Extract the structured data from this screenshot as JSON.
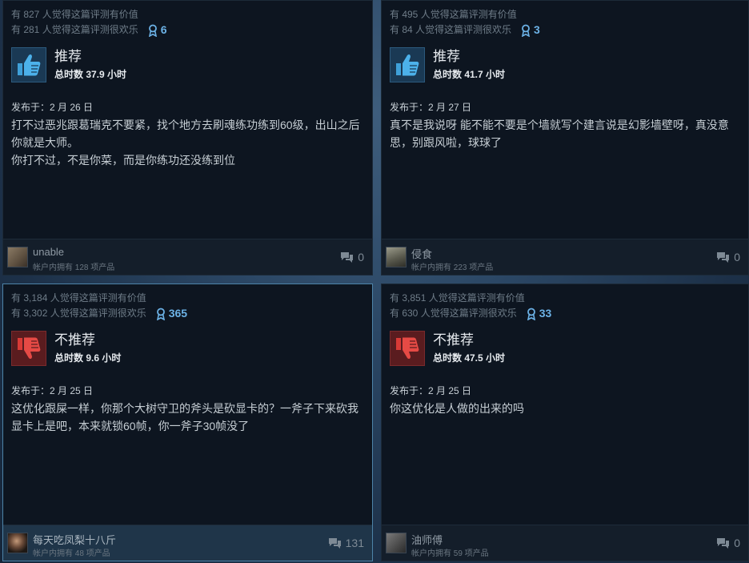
{
  "reviews": [
    {
      "helpful": "有 827 人觉得这篇评测有价值",
      "funny": "有 281 人觉得这篇评测很欢乐",
      "awards": "6",
      "recommendation": "推荐",
      "hours": "总时数 37.9 小时",
      "posted": "发布于：2 月 26 日",
      "text": [
        "打不过恶兆跟葛瑞克不要紧，找个地方去刷魂练功练到60级，出山之后你就是大师。",
        "你打不过，不是你菜，而是你练功还没练到位"
      ],
      "username": "unable",
      "products": "帐户内拥有 128 项产品",
      "comments": "0"
    },
    {
      "helpful": "有 495 人觉得这篇评测有价值",
      "funny": "有 84 人觉得这篇评测很欢乐",
      "awards": "3",
      "recommendation": "推荐",
      "hours": "总时数 41.7 小时",
      "posted": "发布于：2 月 27 日",
      "text": [
        "真不是我说呀 能不能不要是个墙就写个建言说是幻影墙壁呀，真没意思，别跟风啦，球球了"
      ],
      "username": "侵食",
      "products": "帐户内拥有 223 项产品",
      "comments": "0"
    },
    {
      "helpful": "有 3,184 人觉得这篇评测有价值",
      "funny": "有 3,302 人觉得这篇评测很欢乐",
      "awards": "365",
      "recommendation": "不推荐",
      "hours": "总时数 9.6 小时",
      "posted": "发布于：2 月 25 日",
      "text": [
        "这优化跟屎一样，你那个大树守卫的斧头是砍显卡的？一斧子下来砍我显卡上是吧，本来就锁60帧，你一斧子30帧没了"
      ],
      "username": "每天吃凤梨十八斤",
      "products": "帐户内拥有 48 项产品",
      "comments": "131"
    },
    {
      "helpful": "有 3,851 人觉得这篇评测有价值",
      "funny": "有 630 人觉得这篇评测很欢乐",
      "awards": "33",
      "recommendation": "不推荐",
      "hours": "总时数 47.5 小时",
      "posted": "发布于：2 月 25 日",
      "text": [
        "你这优化是人做的出来的吗"
      ],
      "username": "油师傅",
      "products": "帐户内拥有 59 项产品",
      "comments": "0"
    }
  ],
  "icons": {
    "award": "award-ribbon-icon",
    "thumbs_up": "thumbs-up-icon",
    "thumbs_down": "thumbs-down-icon",
    "comment": "comment-bubble-icon"
  },
  "colors": {
    "positive": "#3fa0d8",
    "negative": "#e0403c",
    "award": "#6cb2e6"
  }
}
